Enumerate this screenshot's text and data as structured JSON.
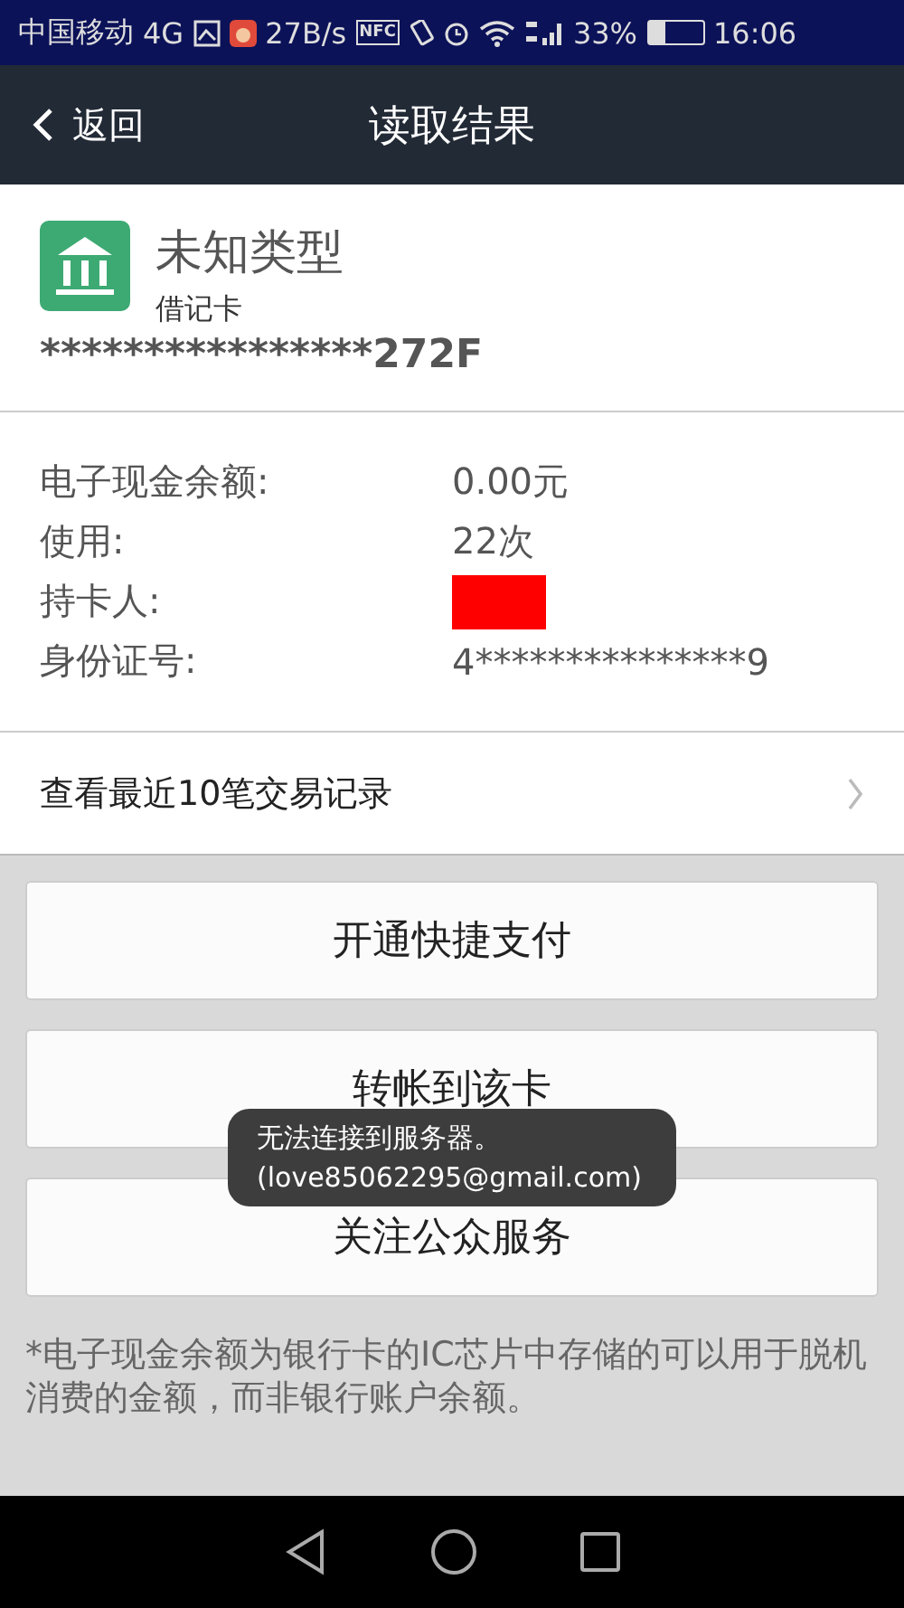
{
  "status_bar": {
    "carrier": "中国移动",
    "network": "4G",
    "speed": "27B/s",
    "nfc": "NFC",
    "battery_percent": "33%",
    "time": "16:06"
  },
  "header": {
    "back": "返回",
    "title": "读取结果"
  },
  "card": {
    "type": "未知类型",
    "subtype": "借记卡",
    "number": "****************272F"
  },
  "info": [
    {
      "label": "电子现金余额:",
      "value": "0.00元",
      "kind": "text"
    },
    {
      "label": "使用:",
      "value": "22次",
      "kind": "text"
    },
    {
      "label": "持卡人:",
      "kind": "redacted"
    },
    {
      "label": "身份证号:",
      "value": "4***************9",
      "kind": "text"
    }
  ],
  "transactions_link": "查看最近10笔交易记录",
  "buttons": [
    "开通快捷支付",
    "转帐到该卡",
    "关注公众服务"
  ],
  "toast": [
    "无法连接到服务器。",
    "(love85062295@gmail.com)"
  ],
  "note": "*电子现金余额为银行卡的IC芯片中存储的可以用于脱机消费的金额，而非银行账户余额。"
}
